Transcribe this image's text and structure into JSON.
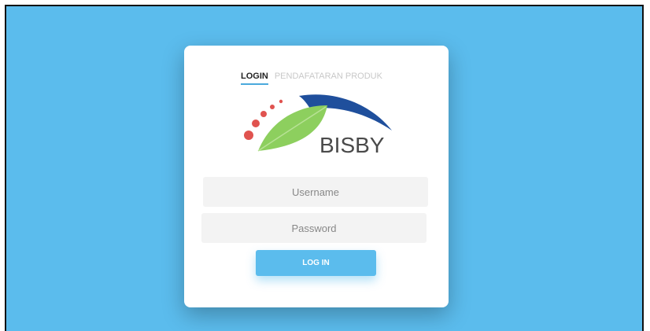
{
  "tabs": {
    "login": "LOGIN",
    "registration": "PENDAFATARAN PRODUK"
  },
  "logo": {
    "text": "BISBY",
    "colors": {
      "leaf_green": "#8dcf5e",
      "wing_blue": "#1f4f9c",
      "dots_red": "#e0534f",
      "text_gray": "#4a4a4a"
    }
  },
  "form": {
    "username_placeholder": "Username",
    "password_placeholder": "Password",
    "submit_label": "LOG IN"
  },
  "colors": {
    "background": "#5bbced",
    "card": "#ffffff",
    "accent": "#4aa9dc"
  }
}
